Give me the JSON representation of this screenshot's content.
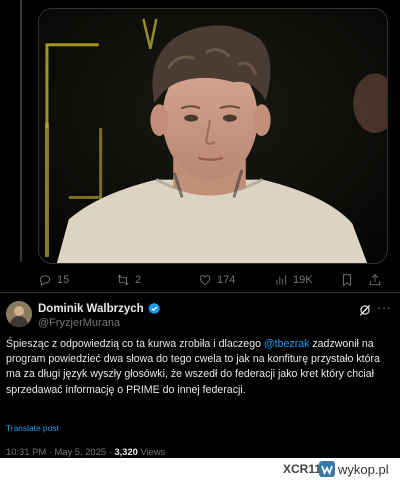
{
  "media": {
    "alt": "Photo of a young man with curly hair in a light sweater"
  },
  "actions": {
    "replies": "15",
    "reposts": "2",
    "likes": "174",
    "views": "19K"
  },
  "author": {
    "name": "Dominik Walbrzych",
    "handle": "@FryzjerMurana"
  },
  "tweet": {
    "text_before": "Śpiesząc z odpowiedzią co ta kurwa zrobiła i dlaczego ",
    "mention": "@tbezrak",
    "text_after": " zadzwonił na program powiedzieć dwa słowa do tego cwela to jak na konfiturę przystało która ma za długi język wyszły głosówki, że wszedł do federacji jako kret który chciał sprzedawać informację o PRIME do innej federacji.",
    "translate_label": "Translate post",
    "time": "10:31 PM",
    "date": "May 5, 2025",
    "views_count": "3,320",
    "views_label": "Views"
  },
  "watermark": {
    "user": "XCR11",
    "separator": "z",
    "site": "wykop.pl"
  },
  "colors": {
    "accent": "#1d9bf0",
    "muted": "#71767b",
    "background": "#000000"
  }
}
